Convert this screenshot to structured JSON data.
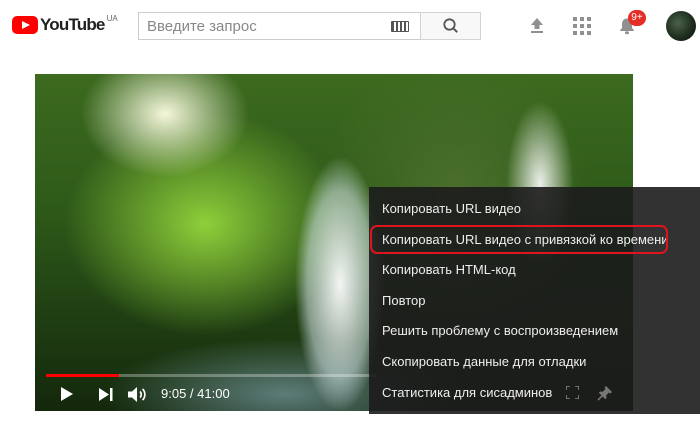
{
  "header": {
    "logo_text": "YouTube",
    "logo_region": "UA",
    "search_placeholder": "Введите запрос",
    "notifications_badge": "9+",
    "icons": [
      "youtube-logo-icon",
      "keyboard-icon",
      "search-icon",
      "upload-icon",
      "apps-icon",
      "bell-icon",
      "avatar"
    ]
  },
  "player": {
    "time": "9:05 / 41:00",
    "progress_fraction": 0.22,
    "icons": [
      "play-icon",
      "next-icon",
      "volume-icon",
      "fullscreen-icon",
      "pin-icon"
    ]
  },
  "context_menu": {
    "items": [
      {
        "label": "Копировать URL видео"
      },
      {
        "label": "Копировать URL видео с привязкой ко времени",
        "highlighted": true
      },
      {
        "label": "Копировать HTML-код"
      },
      {
        "label": "Повтор"
      },
      {
        "label": "Решить проблему с воспроизведением"
      },
      {
        "label": "Скопировать данные для отладки"
      },
      {
        "label": "Статистика для сисадминов"
      }
    ]
  },
  "colors": {
    "brand_red": "#ff0000",
    "highlight_outline": "#e0141e",
    "badge_red": "#e52d27",
    "menu_bg": "#1c1c1c"
  }
}
